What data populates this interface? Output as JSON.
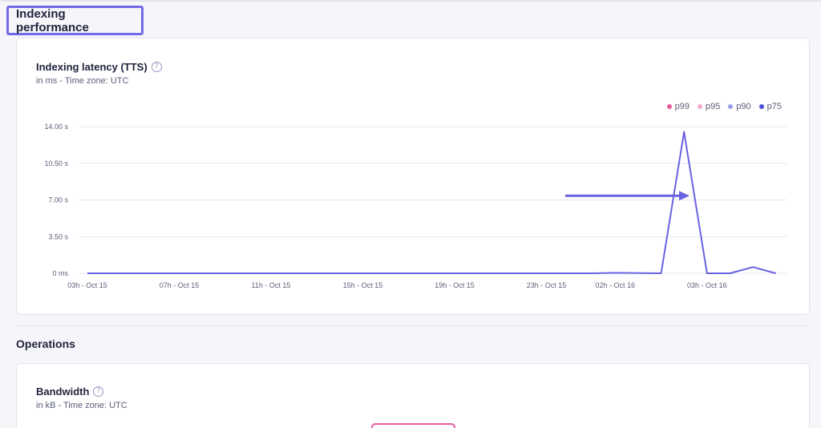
{
  "section": {
    "title": "Indexing performance"
  },
  "latency_card": {
    "title": "Indexing latency (TTS)",
    "help_glyph": "?",
    "subtitle": "in ms - Time zone: UTC"
  },
  "legend": [
    {
      "label": "p99",
      "color": "#e8599b"
    },
    {
      "label": "p95",
      "color": "#f4a9cf"
    },
    {
      "label": "p90",
      "color": "#9a9ce8"
    },
    {
      "label": "p75",
      "color": "#4b4fd8"
    }
  ],
  "operations": {
    "title": "Operations"
  },
  "bandwidth_card": {
    "title": "Bandwidth",
    "help_glyph": "?",
    "subtitle": "in kB - Time zone: UTC"
  },
  "chart_data": {
    "type": "line",
    "y_tick_labels": [
      "0 ms",
      "3.50 s",
      "7.00 s",
      "10.50 s",
      "14.00 s"
    ],
    "y_tick_values": [
      0,
      3.5,
      7,
      10.5,
      14
    ],
    "ylim": [
      0,
      14
    ],
    "x_tick_labels": [
      "03h - Oct 15",
      "07h - Oct 15",
      "11h - Oct 15",
      "15h - Oct 15",
      "19h - Oct 15",
      "23h - Oct 15",
      "02h - Oct 16",
      "03h - Oct 16"
    ],
    "x_tick_hours": [
      0,
      4,
      8,
      12,
      16,
      20,
      23,
      27
    ],
    "xlim_hours": [
      0,
      30.5
    ],
    "grid": true,
    "legend_position": "top-right",
    "series": [
      {
        "name": "p75",
        "color": "#6a62e0",
        "x_hours": [
          0,
          20,
          22,
          23,
          25,
          26,
          27,
          28,
          29,
          30
        ],
        "y_seconds": [
          0,
          0,
          0,
          0.05,
          0,
          13.5,
          0,
          0,
          0.6,
          0
        ]
      }
    ],
    "annotation": {
      "type": "arrow",
      "color": "#6a62e0",
      "pointing": "right, toward the 13.5 s spike"
    }
  }
}
